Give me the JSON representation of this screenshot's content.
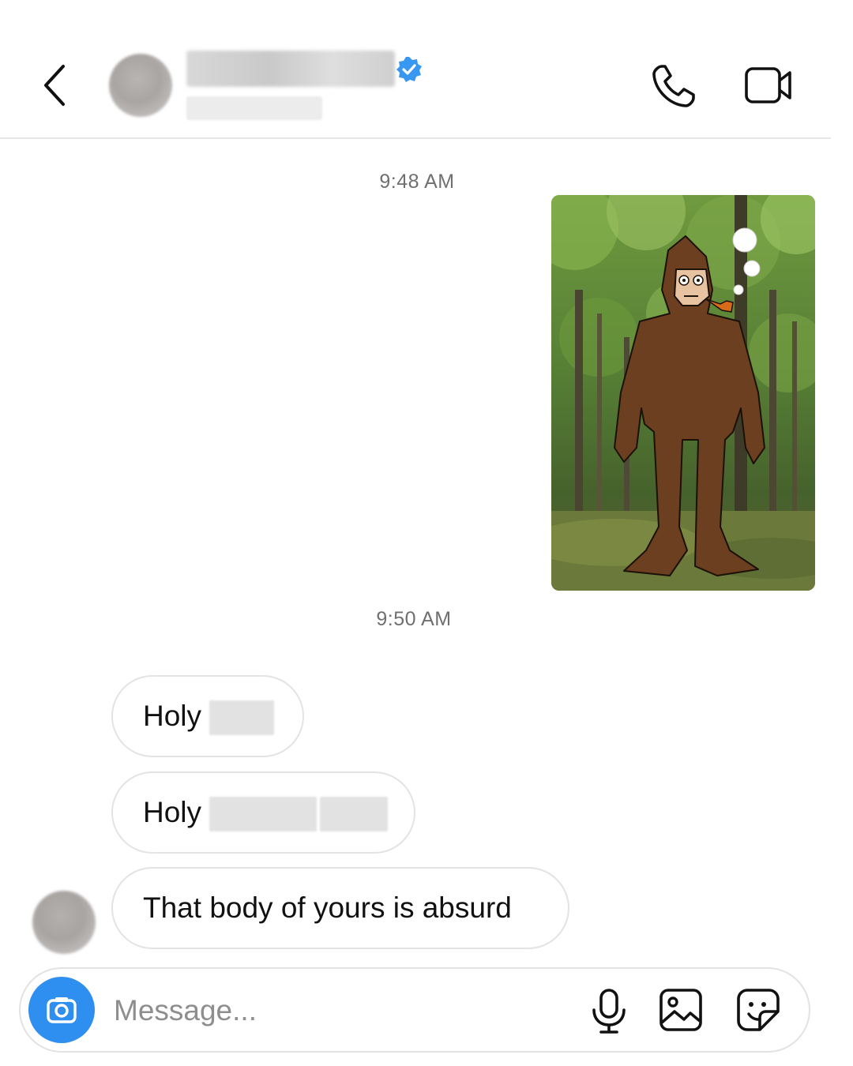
{
  "header": {
    "back_icon": "chevron-left-icon",
    "verified_icon": "verified-badge-icon",
    "verified_color": "#3897f0",
    "call_icon": "phone-icon",
    "video_icon": "video-camera-icon"
  },
  "thread": {
    "timestamps": [
      "9:48 AM",
      "9:50 AM"
    ],
    "shared_image": {
      "description": "photo-message"
    },
    "messages": [
      {
        "text": "Holy"
      },
      {
        "text": "Holy"
      },
      {
        "text": "That body of yours is absurd"
      }
    ]
  },
  "composer": {
    "placeholder": "Message...",
    "camera_color": "#2f8ff0",
    "icons": [
      "camera-icon",
      "microphone-icon",
      "gallery-icon",
      "sticker-icon"
    ]
  }
}
